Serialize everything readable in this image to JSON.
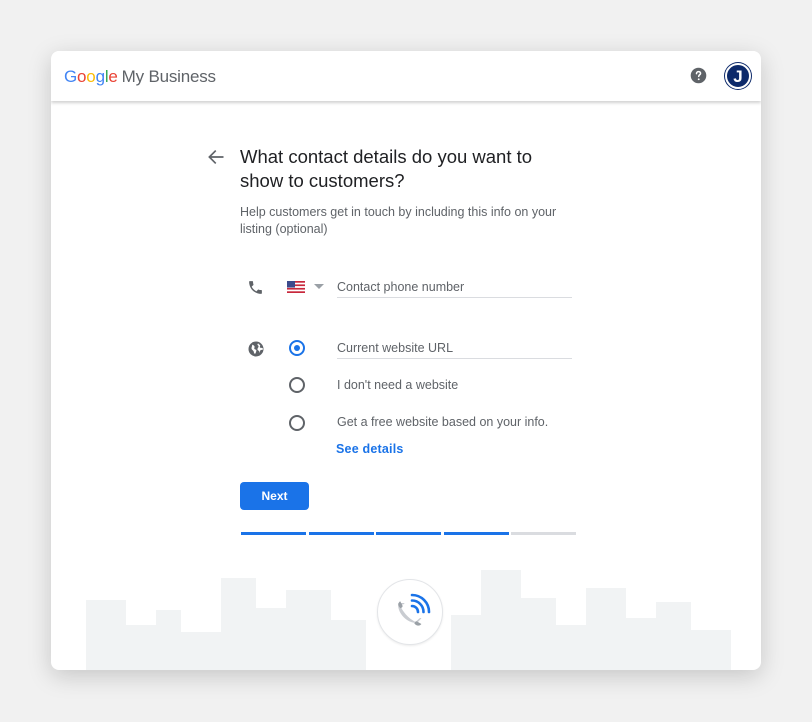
{
  "brand": {
    "google_letters": [
      "G",
      "o",
      "o",
      "g",
      "l",
      "e"
    ],
    "product": "My Business"
  },
  "header": {
    "help_icon": "help-circle-icon",
    "avatar_initial": "J",
    "avatar_color": "#0d2a6b"
  },
  "page": {
    "back_icon": "arrow-back-icon",
    "title": "What contact details do you want to show to customers?",
    "subtitle": "Help customers get in touch by including this info on your listing (optional)"
  },
  "phone": {
    "icon": "phone-icon",
    "country_flag": "us-flag-icon",
    "placeholder": "Contact phone number"
  },
  "website": {
    "icon": "globe-icon",
    "options": [
      {
        "label": "Current website URL",
        "checked": true
      },
      {
        "label": "I don't need a website",
        "checked": false
      },
      {
        "label": "Get a free website based on your info.",
        "checked": false
      }
    ],
    "details_link": "See details"
  },
  "actions": {
    "next_label": "Next"
  },
  "progress": {
    "completed_steps": 4,
    "total_steps": 5
  },
  "illustration": {
    "icon": "phone-call-icon"
  },
  "colors": {
    "accent": "#1a73e8",
    "text_primary": "#202124",
    "text_secondary": "#5f6368"
  }
}
